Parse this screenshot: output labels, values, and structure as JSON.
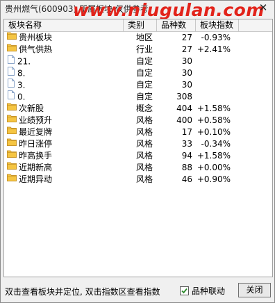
{
  "window": {
    "title": "贵州燃气(600903)  所属板块  仅供参考",
    "watermark": "www.niugulan.com",
    "close_glyph": "✕"
  },
  "table": {
    "columns": [
      "板块名称",
      "类别",
      "品种数",
      "板块指数"
    ],
    "rows": [
      {
        "icon": "folder-icon",
        "name": "贵州板块",
        "category": "地区",
        "count": "27",
        "index": "-0.93%"
      },
      {
        "icon": "folder-icon",
        "name": "供气供热",
        "category": "行业",
        "count": "27",
        "index": "+2.41%"
      },
      {
        "icon": "document-icon",
        "name": "21.",
        "category": "自定",
        "count": "30",
        "index": ""
      },
      {
        "icon": "document-icon",
        "name": "8.",
        "category": "自定",
        "count": "30",
        "index": ""
      },
      {
        "icon": "document-icon",
        "name": "3.",
        "category": "自定",
        "count": "30",
        "index": ""
      },
      {
        "icon": "document-icon",
        "name": "0.",
        "category": "自定",
        "count": "308",
        "index": ""
      },
      {
        "icon": "folder-icon",
        "name": "次新股",
        "category": "概念",
        "count": "404",
        "index": "+1.58%"
      },
      {
        "icon": "folder-icon",
        "name": "业绩预升",
        "category": "风格",
        "count": "400",
        "index": "+0.58%"
      },
      {
        "icon": "folder-icon",
        "name": "最近复牌",
        "category": "风格",
        "count": "17",
        "index": "+0.10%"
      },
      {
        "icon": "folder-icon",
        "name": "昨日涨停",
        "category": "风格",
        "count": "33",
        "index": "-0.34%"
      },
      {
        "icon": "folder-icon",
        "name": "昨高换手",
        "category": "风格",
        "count": "94",
        "index": "+1.58%"
      },
      {
        "icon": "folder-icon",
        "name": "近期新高",
        "category": "风格",
        "count": "88",
        "index": "+0.00%"
      },
      {
        "icon": "folder-icon",
        "name": "近期异动",
        "category": "风格",
        "count": "46",
        "index": "+0.90%"
      }
    ]
  },
  "status": {
    "hint": "双击查看板块并定位, 双击指数区查看指数",
    "sync_label": "品种联动",
    "sync_checked": true,
    "close_label": "关闭"
  },
  "colors": {
    "folder": "#f5c542",
    "folder_edge": "#c9962a",
    "document_edge": "#8aa4c8",
    "check": "#2a8a2a",
    "watermark": "#e2231a"
  }
}
